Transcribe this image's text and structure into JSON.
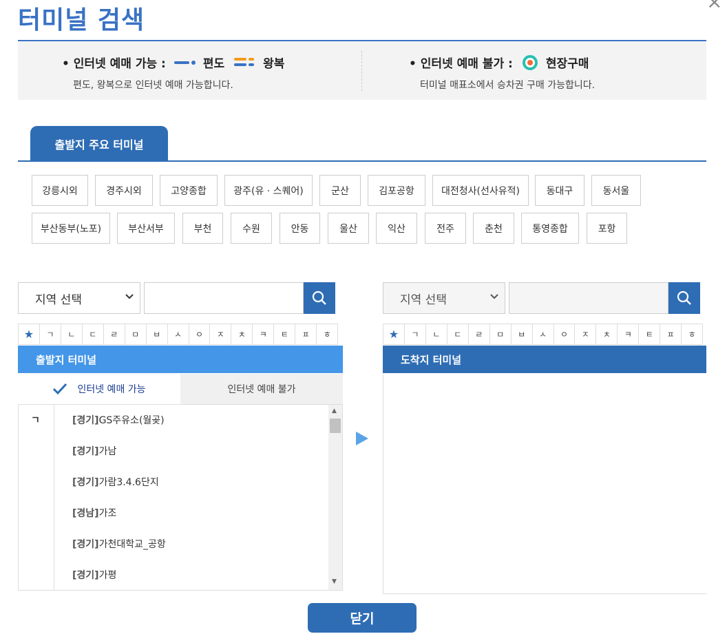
{
  "title": "터미널 검색",
  "legend": {
    "online_label": "• 인터넷 예매 가능 :",
    "oneway_label": "편도",
    "round_label": "왕복",
    "online_desc": "편도, 왕복으로 인터넷 예매 가능합니다.",
    "offline_label": "• 인터넷 예매 불가 :",
    "spot_label": "현장구매",
    "offline_desc": "터미널 매표소에서 승차권 구매 가능합니다."
  },
  "tab_label": "출발지 주요 터미널",
  "terminals_row1": [
    "강릉시외",
    "경주시외",
    "고양종합",
    "광주(유 · 스퀘어)",
    "군산",
    "김포공항",
    "대전청사(선사유적)",
    "동대구",
    "동서울"
  ],
  "terminals_row2": [
    "부산동부(노포)",
    "부산서부",
    "부천",
    "수원",
    "안동",
    "울산",
    "익산",
    "전주",
    "춘천",
    "통영종합",
    "포항"
  ],
  "left": {
    "region_select": "지역 선택",
    "header": "출발지 터미널",
    "subtab_online": "인터넷 예매 가능",
    "subtab_offline": "인터넷 예매 불가",
    "index_letter": "ㄱ",
    "items": [
      {
        "region": "[경기]",
        "name": "GS주유소(월곶)"
      },
      {
        "region": "[경기]",
        "name": "가남"
      },
      {
        "region": "[경기]",
        "name": "가람3.4.6단지"
      },
      {
        "region": "[경남]",
        "name": "가조"
      },
      {
        "region": "[경기]",
        "name": "가천대학교_공항"
      },
      {
        "region": "[경기]",
        "name": "가평"
      }
    ]
  },
  "right": {
    "region_select": "지역 선택",
    "header": "도착지 터미널"
  },
  "consonants": [
    "ㄱ",
    "ㄴ",
    "ㄷ",
    "ㄹ",
    "ㅁ",
    "ㅂ",
    "ㅅ",
    "ㅇ",
    "ㅈ",
    "ㅊ",
    "ㅋ",
    "ㅌ",
    "ㅍ",
    "ㅎ"
  ],
  "close_button": "닫기",
  "colors": {
    "brand": "#2e6db4",
    "left_header": "#4496e8",
    "accent_light": "#5aa3e6"
  },
  "icons": [
    "close-icon",
    "search-icon",
    "star-icon",
    "check-icon",
    "triangle-right-icon",
    "chevron-down-icon"
  ]
}
